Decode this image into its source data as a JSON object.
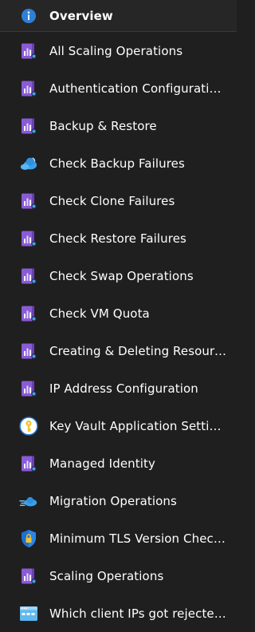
{
  "nav": {
    "overview": {
      "label": "Overview",
      "icon": "info-icon"
    },
    "items": [
      {
        "label": "All Scaling Operations",
        "icon": "workbook-icon"
      },
      {
        "label": "Authentication Configuration ...",
        "icon": "workbook-icon"
      },
      {
        "label": "Backup & Restore",
        "icon": "workbook-icon"
      },
      {
        "label": "Check Backup Failures",
        "icon": "cloud-backup-icon"
      },
      {
        "label": "Check Clone Failures",
        "icon": "workbook-icon"
      },
      {
        "label": "Check Restore Failures",
        "icon": "workbook-icon"
      },
      {
        "label": "Check Swap Operations",
        "icon": "workbook-icon"
      },
      {
        "label": "Check VM Quota",
        "icon": "workbook-icon"
      },
      {
        "label": "Creating & Deleting Resources",
        "icon": "workbook-icon"
      },
      {
        "label": "IP Address Configuration",
        "icon": "workbook-icon"
      },
      {
        "label": "Key Vault Application Setting...",
        "icon": "key-icon"
      },
      {
        "label": "Managed Identity",
        "icon": "workbook-icon"
      },
      {
        "label": "Migration Operations",
        "icon": "cloud-migration-icon"
      },
      {
        "label": "Minimum TLS Version Checker",
        "icon": "shield-lock-icon"
      },
      {
        "label": "Scaling Operations",
        "icon": "workbook-icon"
      },
      {
        "label": "Which client IPs got rejected ...",
        "icon": "web-window-icon"
      }
    ]
  },
  "colors": {
    "background": "#1f1f1f",
    "selected_background": "#262626",
    "text": "#ffffff",
    "workbook_purple": "#8a5bd6",
    "info_blue": "#2f7fd6"
  }
}
